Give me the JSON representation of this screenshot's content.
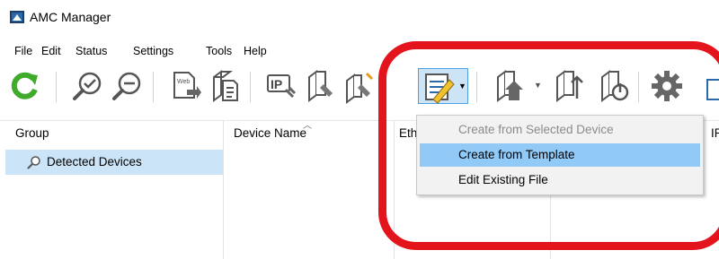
{
  "window": {
    "title": "AMC Manager"
  },
  "menu": [
    "File",
    "Edit",
    "Status",
    "Settings",
    "Tools",
    "Help"
  ],
  "toolbar": {
    "buttons": [
      "refresh-icon",
      "search-device-icon",
      "search-ip-icon",
      "web-page-icon",
      "device-info-icon",
      "ip-settings-icon",
      "device-settings-icon",
      "apply-settings-icon",
      "create-edit-settings-icon",
      "firmware-update-icon",
      "firmware-info-icon",
      "power-icon",
      "gear-icon"
    ]
  },
  "columns": {
    "group": "Group",
    "device_name": "Device Name",
    "eth": "Eth",
    "ip_partial": "IP"
  },
  "tree": {
    "detected_devices": "Detected Devices"
  },
  "dropdown": {
    "items": [
      {
        "label": "Create from Selected Device",
        "state": "disabled"
      },
      {
        "label": "Create from Template",
        "state": "hover"
      },
      {
        "label": "Edit Existing File",
        "state": "normal"
      }
    ]
  },
  "colors": {
    "highlight_ring": "#e3141c",
    "selection": "#cce4f7",
    "menu_hover": "#91c9f7",
    "refresh_green": "#3faa2c"
  }
}
